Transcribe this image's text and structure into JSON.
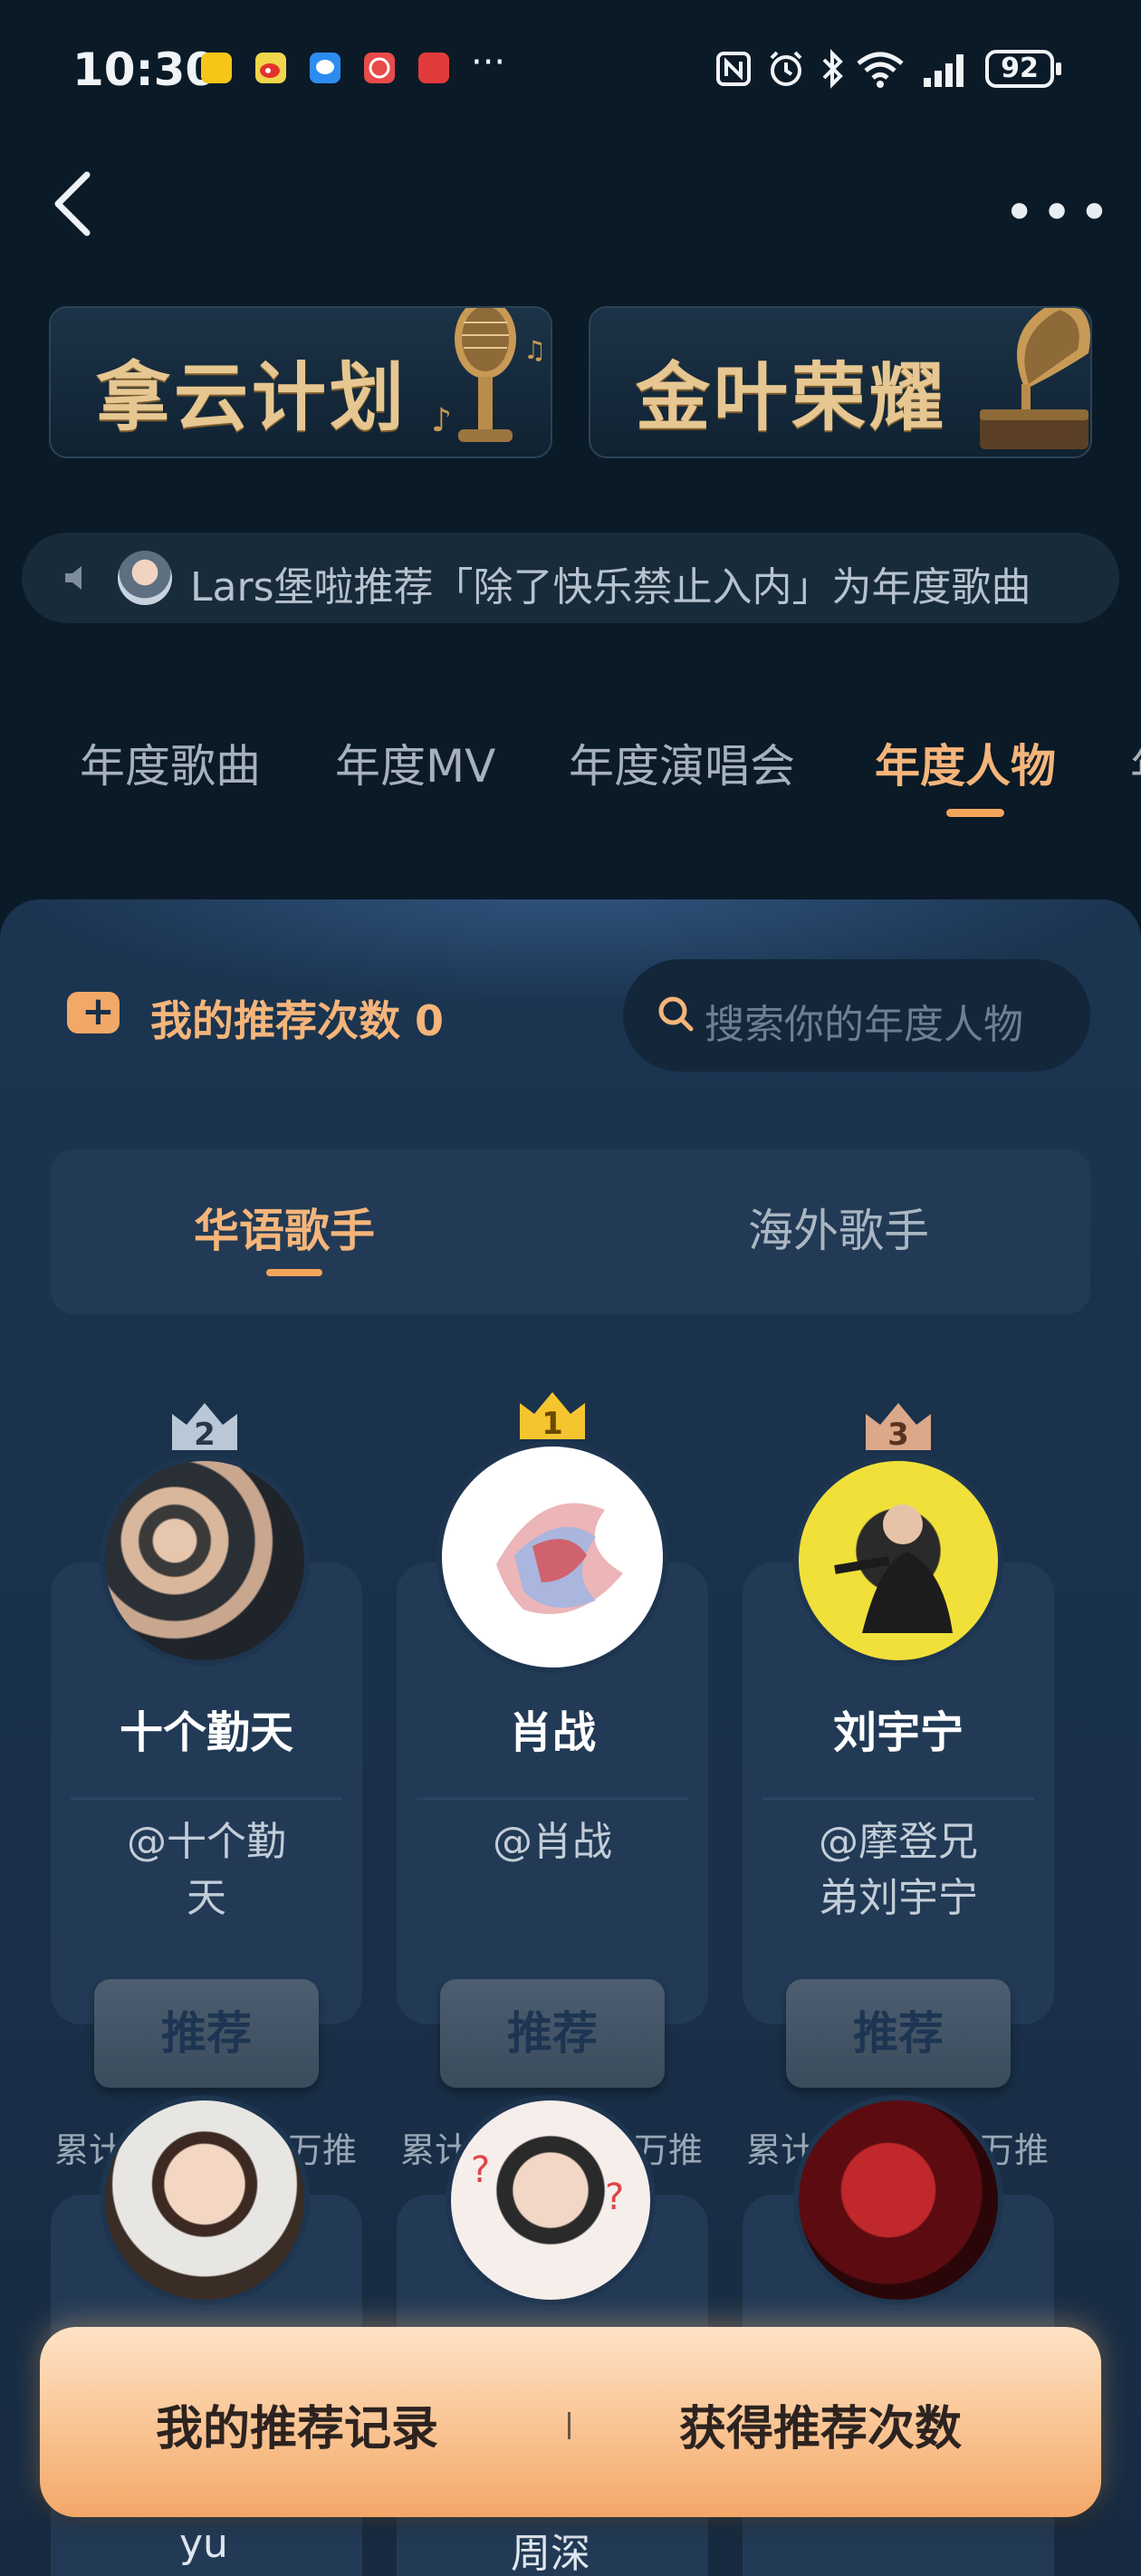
{
  "status_bar": {
    "time": "10:30",
    "battery": "92",
    "more_dots": "···",
    "app_icons": [
      "meituan-icon",
      "weibo-icon",
      "chat-bubble-icon",
      "bank-icon",
      "huawei-icon"
    ],
    "system_icons": [
      "nfc-icon",
      "alarm-icon",
      "bluetooth-icon",
      "wifi-icon",
      "signal-icon"
    ]
  },
  "header": {
    "back_icon": "back-arrow-icon",
    "more_label": "•••"
  },
  "banners": [
    {
      "label": "拿云计划",
      "icon": "microphone-icon"
    },
    {
      "label": "金叶荣耀",
      "icon": "gramophone-icon"
    }
  ],
  "ticker": {
    "text": "Lars堡啦推荐「除了快乐禁止入内」为年度歌曲"
  },
  "tabs": [
    {
      "label": "年度歌曲",
      "active": false
    },
    {
      "label": "年度MV",
      "active": false
    },
    {
      "label": "年度演唱会",
      "active": false
    },
    {
      "label": "年度人物",
      "active": true
    },
    {
      "label": "年",
      "active": false
    }
  ],
  "panel": {
    "rec_count_label": "我的推荐次数 0",
    "search_placeholder": "搜索你的年度人物",
    "segments": [
      {
        "label": "华语歌手",
        "active": true
      },
      {
        "label": "海外歌手",
        "active": false
      }
    ]
  },
  "cards": [
    {
      "rank": "2",
      "name": "十个勤天",
      "handle_line1": "@十个勤",
      "handle_line2": "天",
      "button": "推荐",
      "stat_left": "累计",
      "stat_right": "万推"
    },
    {
      "rank": "1",
      "name": "肖战",
      "handle_line1": "@肖战",
      "handle_line2": "",
      "button": "推荐",
      "stat_left": "累计",
      "stat_right": "万推"
    },
    {
      "rank": "3",
      "name": "刘宇宁",
      "handle_line1": "@摩登兄",
      "handle_line2": "弟刘宇宁",
      "button": "推荐",
      "stat_left": "累计",
      "stat_right": "万推"
    }
  ],
  "second_row_names": [
    "yu",
    "周深",
    ""
  ],
  "bottom_bar": {
    "left_label": "我的推荐记录",
    "right_label": "获得推荐次数"
  },
  "colors": {
    "accent": "#f4b57a",
    "background": "#0b1a27",
    "panel": "#1b3450"
  }
}
